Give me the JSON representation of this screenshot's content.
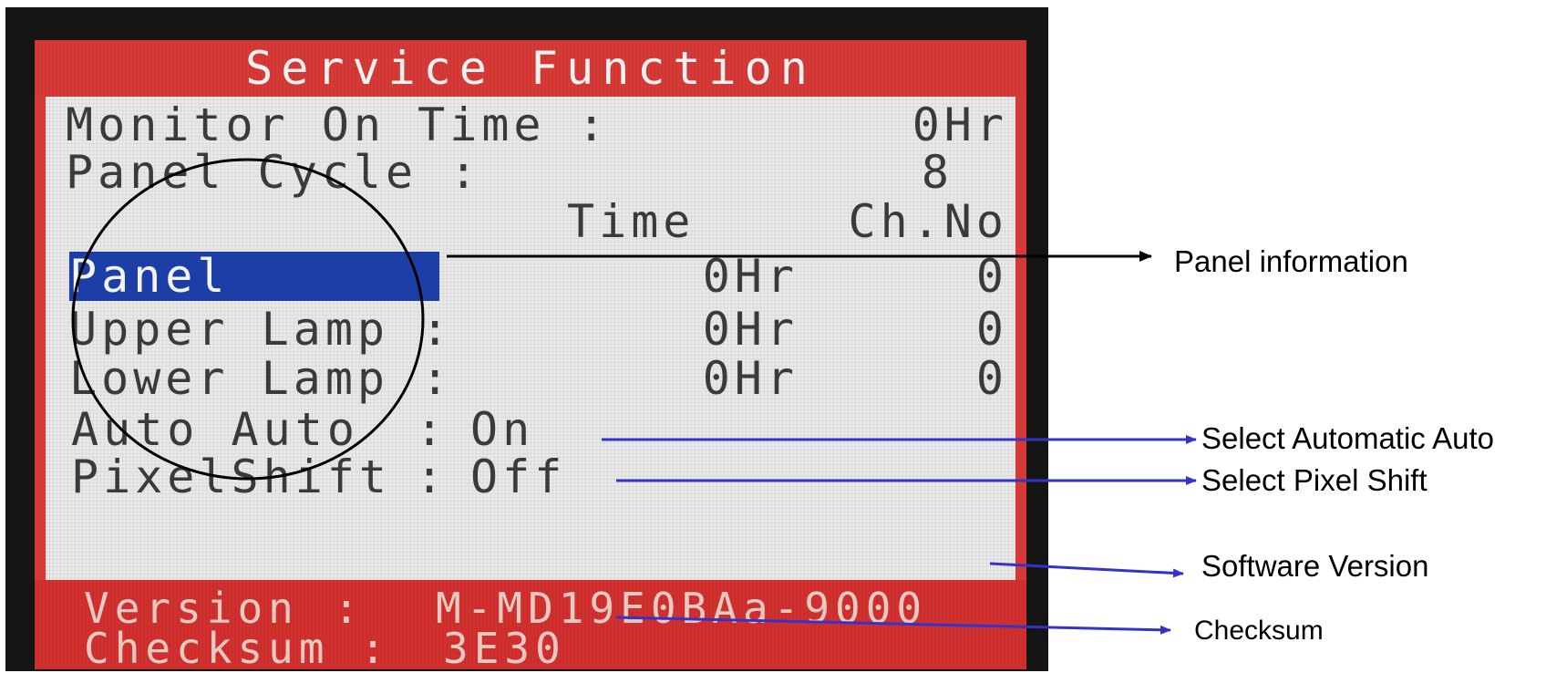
{
  "screen": {
    "title": "Service Function",
    "monitor_on_time": {
      "label": "Monitor On Time :",
      "value": "0Hr"
    },
    "panel_cycle": {
      "label": "Panel Cycle :",
      "value": "8"
    },
    "columns": {
      "time": "Time",
      "channel": "Ch.No"
    },
    "rows": [
      {
        "label": "Panel",
        "time": "0Hr",
        "channel": "0",
        "selected": true
      },
      {
        "label": "Upper Lamp :",
        "time": "0Hr",
        "channel": "0"
      },
      {
        "label": "Lower Lamp :",
        "time": "0Hr",
        "channel": "0"
      }
    ],
    "auto_auto": {
      "label": "Auto Auto",
      "separator": ":",
      "value": "On"
    },
    "pixel_shift": {
      "label": "PixelShift",
      "separator": ":",
      "value": "Off"
    },
    "version": {
      "label": "Version",
      "separator": ":",
      "value": "M-MD19E0BAa-9000"
    },
    "checksum": {
      "label": "Checksum :",
      "value": "3E30"
    }
  },
  "annotations": {
    "panel_information": "Panel information",
    "auto": "Select Automatic Auto",
    "pixel_shift": "Select Pixel Shift",
    "software_version": "Software Version",
    "checksum": "Checksum"
  },
  "colors": {
    "osd_red": "#d63a36",
    "osd_highlight": "#1b3fa6",
    "annotation_arrow_blue": "#3333cc",
    "annotation_arrow_black": "#000000"
  }
}
